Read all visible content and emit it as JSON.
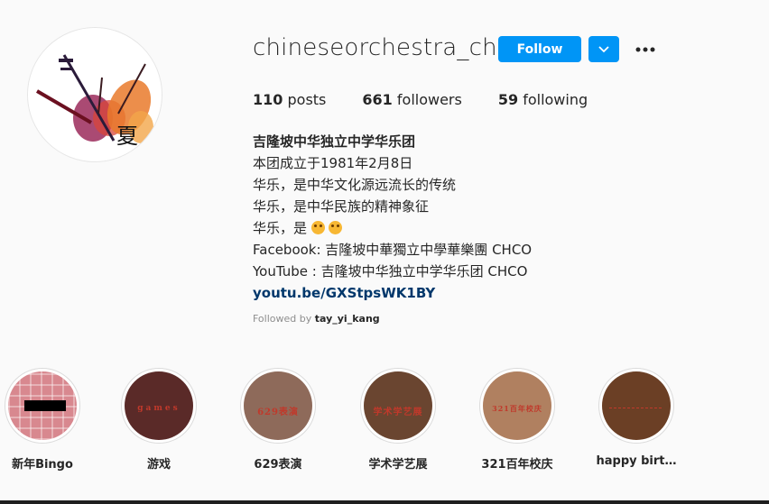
{
  "profile": {
    "username": "chineseorchestra_chkl",
    "follow_label": "Follow",
    "avatar_char": "夏",
    "stats": {
      "posts_count": "110",
      "posts_label": "posts",
      "followers_count": "661",
      "followers_label": "followers",
      "following_count": "59",
      "following_label": "following"
    },
    "bio": {
      "name": "吉隆坡中华独立中学华乐团",
      "line1": "本团成立于1981年2月8日",
      "line2": "华乐，是中华文化源远流长的传统",
      "line3": "华乐，是中华民族的精神象征",
      "line4": "华乐，是",
      "line5": "Facebook: 吉隆坡中華獨立中學華樂團 CHCO",
      "line6": "YouTube : 吉隆坡中华独立中学华乐团 CHCO",
      "link": "youtu.be/GXStpsWK1BY"
    },
    "followed_by_prefix": "Followed by",
    "followed_by_user": "tay_yi_kang"
  },
  "highlights": [
    {
      "label": "新年Bingo",
      "title": "",
      "bg": "#d8888f"
    },
    {
      "label": "游戏",
      "title": "games",
      "bg": "#5a2a28"
    },
    {
      "label": "629表演",
      "title": "629表演",
      "bg": "#8e6a5a"
    },
    {
      "label": "学术学艺展",
      "title": "学术学艺展",
      "bg": "#6a4530"
    },
    {
      "label": "321百年校庆",
      "title": "321百年校庆",
      "bg": "#b08060"
    },
    {
      "label": "happy birt…",
      "title": "",
      "bg": "#6b3f25"
    }
  ],
  "colors": {
    "accent": "#0095f6",
    "link": "#00376b",
    "muted": "#8e8e8e"
  },
  "icons": {
    "dropdown": "chevron-down-icon",
    "more": "more-options-icon"
  }
}
